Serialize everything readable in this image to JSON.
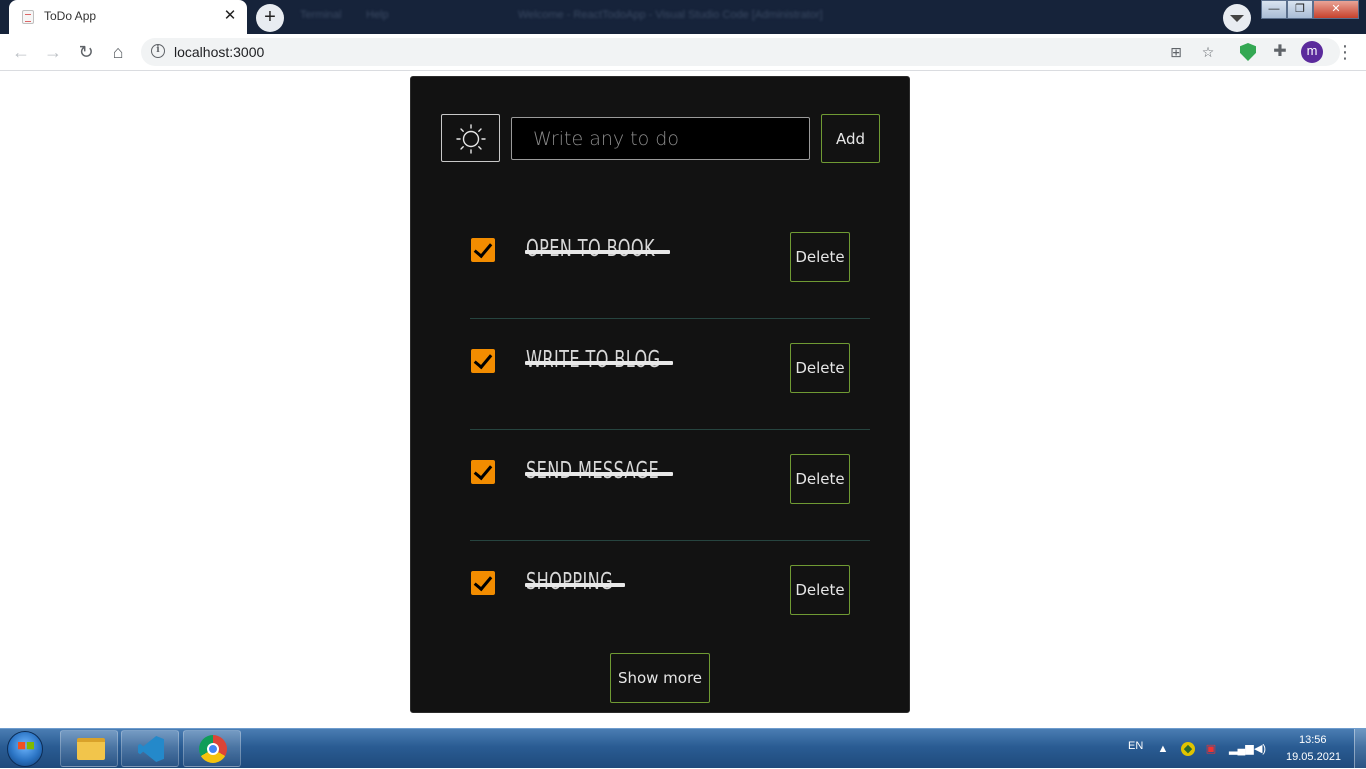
{
  "browser": {
    "tab_title": "ToDo App",
    "tab_close": "✕",
    "new_tab": "+",
    "background_window": [
      "Terminal",
      "Help",
      "Welcome - ReactTodoApp - Visual Studio Code [Administrator]"
    ],
    "url": "localhost:3000",
    "info": "i",
    "back": "←",
    "forward": "→",
    "reload": "↻",
    "home": "⌂",
    "translate": "⊞",
    "bookmark": "☆",
    "puzzle": "✚",
    "avatar_letter": "m",
    "menu": "⋮",
    "window_controls": {
      "minimize": "—",
      "maximize": "❐",
      "close": "✕"
    }
  },
  "app": {
    "theme_icon": "sun-icon",
    "input_placeholder": "Write any to do",
    "add_label": "Add",
    "delete_label": "Delete",
    "show_more_label": "Show more",
    "checkbox_color": "#f28c00",
    "button_border_color": "#6f9a33",
    "todos": [
      {
        "text": "OPEN TO BOOK",
        "completed": true
      },
      {
        "text": "WRITE TO BLOG",
        "completed": true
      },
      {
        "text": "SEND MESSAGE",
        "completed": true
      },
      {
        "text": "SHOPPING",
        "completed": true
      }
    ]
  },
  "taskbar": {
    "apps": [
      "file-explorer-icon",
      "vscode-icon",
      "chrome-icon"
    ],
    "language": "EN",
    "time": "13:56",
    "date": "19.05.2021"
  }
}
